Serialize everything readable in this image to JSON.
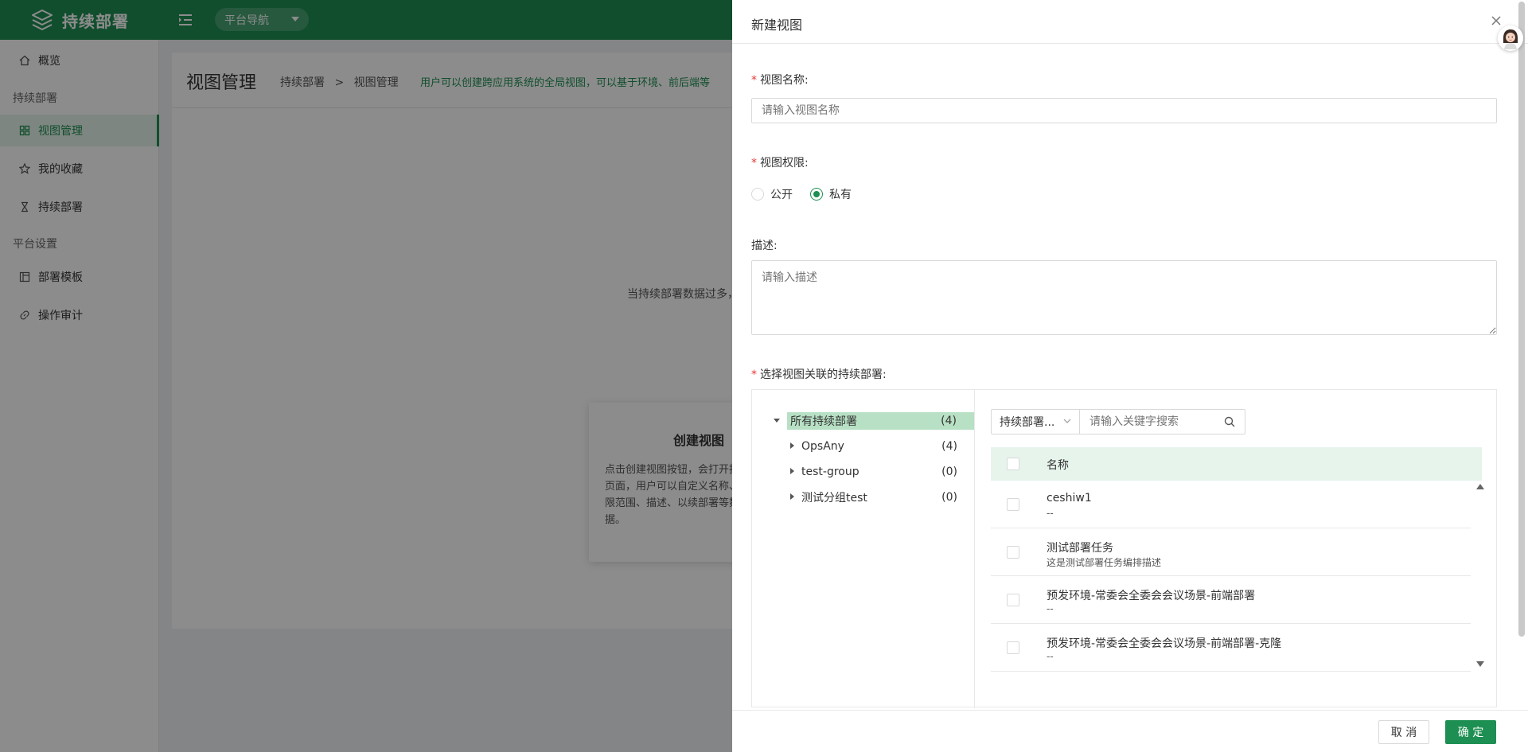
{
  "app": {
    "title": "持续部署",
    "nav_pill": "平台导航"
  },
  "sidebar": {
    "items": [
      {
        "label": "概览",
        "icon": "home-icon"
      },
      {
        "label": "视图管理",
        "icon": "grid-icon",
        "active": true
      },
      {
        "label": "我的收藏",
        "icon": "star-icon"
      },
      {
        "label": "持续部署",
        "icon": "hourglass-icon"
      },
      {
        "label": "部署模板",
        "icon": "template-icon"
      },
      {
        "label": "操作审计",
        "icon": "link-icon"
      }
    ],
    "groups": [
      "持续部署",
      "平台设置"
    ]
  },
  "page": {
    "title": "视图管理",
    "breadcrumb_root": "持续部署",
    "breadcrumb_sep": ">",
    "breadcrumb_current": "视图管理",
    "description": "用户可以创建跨应用系统的全局视图，可以基于环境、前后端等",
    "empty_text": "当持续部署数据过多，",
    "create_card_title": "创建视图",
    "create_card_body": "点击创建视图按钮，会打开抽屉页面，用户可以自定义名称、权限范围、描述、以续部署等数据。"
  },
  "drawer": {
    "title": "新建视图",
    "name_label": "视图名称:",
    "name_placeholder": "请输入视图名称",
    "permission_label": "视图权限:",
    "permission_options": [
      "公开",
      "私有"
    ],
    "permission_selected": "私有",
    "description_label": "描述:",
    "description_placeholder": "请输入描述",
    "select_label": "选择视图关联的持续部署:",
    "tree": [
      {
        "name": "所有持续部署",
        "count": "(4)"
      },
      {
        "name": "OpsAny",
        "count": "(4)"
      },
      {
        "name": "test-group",
        "count": "(0)"
      },
      {
        "name": "测试分组test",
        "count": "(0)"
      }
    ],
    "filter_select": "持续部署...",
    "search_placeholder": "请输入关键字搜索",
    "list_header": "名称",
    "list_rows": [
      {
        "title": "ceshiw1",
        "sub": "--"
      },
      {
        "title": "测试部署任务",
        "sub": "这是测试部署任务编排描述"
      },
      {
        "title": "预发环境-常委会全委会会议场景-前端部署",
        "sub": "--"
      },
      {
        "title": "预发环境-常委会全委会会议场景-前端部署-克隆",
        "sub": "--"
      }
    ],
    "cancel_label": "取 消",
    "ok_label": "确 定"
  },
  "colors": {
    "brand": "#1e8f52",
    "selected_tree": "#b7e0c4",
    "list_header_bg": "#e6f4ec"
  }
}
